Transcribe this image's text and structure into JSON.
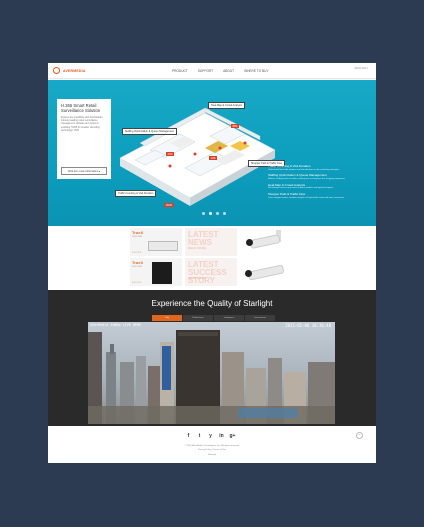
{
  "header": {
    "logo_text": "AVERMEDIA",
    "nav": [
      "PRODUCT",
      "SUPPORT",
      "ABOUT",
      "WHERE TO BUY"
    ],
    "lang": "ENGLISH ▾"
  },
  "hero": {
    "card_title": "H.265 Smart Retail Surveillance Solution",
    "card_body": "Explore the possibility with AVerMedia's industry-leading video surveillance management software and systems enabling H.265 for smarter decoding technology! NVR",
    "card_cta": "Click For more Information ▸",
    "callouts": [
      {
        "label": "Heat Map & Crowd Analysis"
      },
      {
        "label": "Staffing Optimization & Queue Management"
      },
      {
        "label": "Shopper Path & Traffic Flow"
      },
      {
        "label": "Traffic Counting & Visit Duration"
      }
    ],
    "tags": [
      "88%",
      "23%",
      "13%",
      "160%"
    ],
    "features": [
      {
        "heading": "Traffic Counting & Visit Duration",
        "desc": "Understand foot traffic patterns and visit duration to plan marketing strategies."
      },
      {
        "heading": "Staffing Optimization & Queue Management",
        "desc": "Balance staffing levels to reduce waiting time and improve the shopping experience."
      },
      {
        "heading": "Heat Map & Crowd Analysis",
        "desc": "See hotspot areas in your store to place products and optimize layouts."
      },
      {
        "heading": "Shopper Path & Traffic Flow",
        "desc": "Learn shopper routes, combine analytics of high-traffic zones and store conversion."
      }
    ],
    "slide_count": 4,
    "active_slide": 2,
    "brand_color": "#17a9c6"
  },
  "products": {
    "items": [
      {
        "name": "TrueX",
        "sub": "H.265 NVR",
        "strip": "SOLUTION"
      },
      {
        "name": "TrueX",
        "sub": "H.265 NVR",
        "strip": "SOLUTION"
      }
    ],
    "latest": [
      {
        "big": "LATEST NEWS",
        "small": "READ MORE"
      },
      {
        "big": "LATEST SUCCESS STORY",
        "small": "READ MORE"
      }
    ]
  },
  "starlight": {
    "title": "Experience the Quality of Starlight",
    "tabs": [
      "City",
      "Pedestrians",
      "Underpass",
      "Intersection"
    ],
    "active_tab": 0,
    "osd_left": "AVerMedia 1080p LIVE DEMO",
    "osd_right": "2015-01-08 18:36:48"
  },
  "footer": {
    "social": [
      "f",
      "t",
      "y",
      "in",
      "g+"
    ],
    "line1": "© 2015 AVerMedia Technologies, Inc. All rights reserved.",
    "line2": "Privacy Policy | Terms of Use",
    "line3": "Sitemap",
    "to_top": "⌃",
    "accent": "#e0661e"
  }
}
